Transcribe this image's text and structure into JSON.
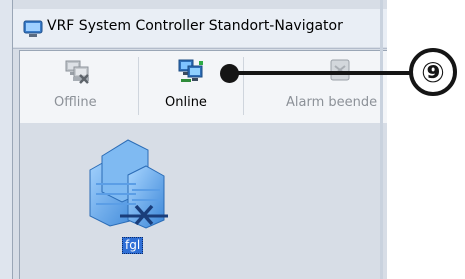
{
  "window": {
    "title": "VRF System Controller Standort-Navigator"
  },
  "toolbar": {
    "buttons": [
      {
        "label": "Offline",
        "icon": "computer-offline-icon",
        "enabled": false
      },
      {
        "label": "Online",
        "icon": "computer-online-icon",
        "enabled": true
      },
      {
        "label": "Alarm beende",
        "icon": "alarm-stop-icon",
        "enabled": false
      }
    ]
  },
  "site": {
    "label": "fgl",
    "icon": "building-disconnected-icon"
  },
  "callout": {
    "number": "⑨"
  },
  "colors": {
    "window_bg": "#d7dde6",
    "toolbar_bg": "#f3f5f8",
    "selection_blue": "#2f6fd6"
  }
}
